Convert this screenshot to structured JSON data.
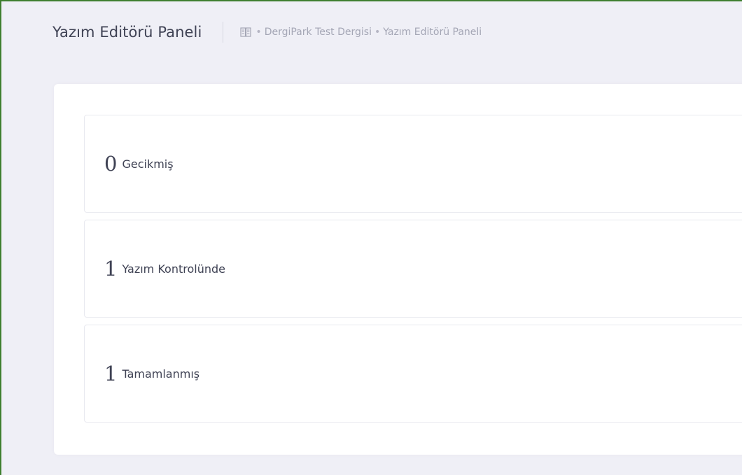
{
  "header": {
    "title": "Yazım Editörü Paneli",
    "breadcrumb": {
      "icon": "book-icon",
      "separator": "•",
      "items": [
        "DergiPark Test Dergisi",
        "Yazım Editörü Paneli"
      ]
    }
  },
  "stats": [
    {
      "value": "0",
      "label": "Gecikmiş"
    },
    {
      "value": "1",
      "label": "Yazım Kontrolünde"
    },
    {
      "value": "1",
      "label": "Tamamlanmış"
    }
  ],
  "colors": {
    "border_frame": "#3f7f2f",
    "background": "#efeff6",
    "card": "#ffffff",
    "text_primary": "#3f4254",
    "text_muted": "#a4a6b5"
  }
}
